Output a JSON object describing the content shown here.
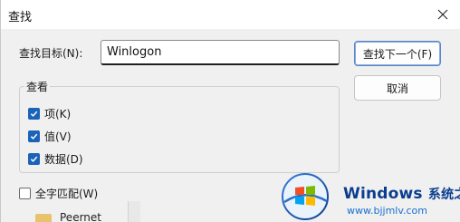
{
  "window": {
    "title": "查找"
  },
  "find": {
    "label": "查找目标(N):",
    "value": "Winlogon"
  },
  "buttons": {
    "find_next": "查找下一个(F)",
    "cancel": "取消"
  },
  "lookat": {
    "title": "查看",
    "options": [
      {
        "label": "项(K)",
        "checked": true
      },
      {
        "label": "值(V)",
        "checked": true
      },
      {
        "label": "数据(D)",
        "checked": true
      }
    ]
  },
  "match_whole": {
    "label": "全字匹配(W)",
    "checked": false
  },
  "background": {
    "tree_item": "Peernet"
  },
  "watermark": {
    "brand": "Windows",
    "brand_cn": "系统之家",
    "url": "www.bjjmlv.com"
  },
  "colors": {
    "accent": "#1b63b8",
    "dialog_bg": "#f0f0f0"
  }
}
